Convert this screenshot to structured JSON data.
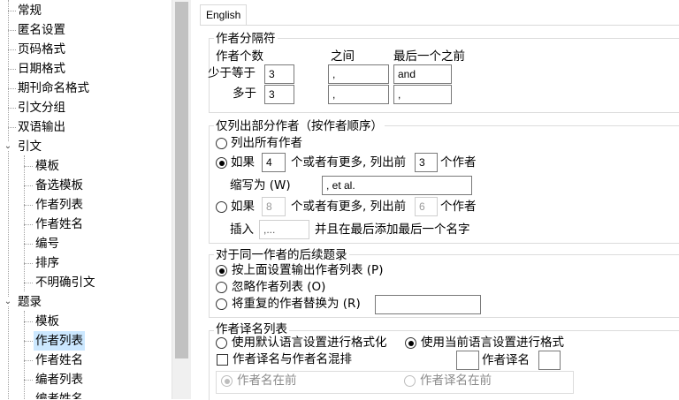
{
  "tree": {
    "items": [
      {
        "label": "常规",
        "level": 0
      },
      {
        "label": "匿名设置",
        "level": 0
      },
      {
        "label": "页码格式",
        "level": 0
      },
      {
        "label": "日期格式",
        "level": 0
      },
      {
        "label": "期刊命名格式",
        "level": 0
      },
      {
        "label": "引文分组",
        "level": 0
      },
      {
        "label": "双语输出",
        "level": 0
      },
      {
        "label": "引文",
        "level": 0,
        "expanded": true
      },
      {
        "label": "模板",
        "level": 1
      },
      {
        "label": "备选模板",
        "level": 1
      },
      {
        "label": "作者列表",
        "level": 1
      },
      {
        "label": "作者姓名",
        "level": 1
      },
      {
        "label": "编号",
        "level": 1
      },
      {
        "label": "排序",
        "level": 1
      },
      {
        "label": "不明确引文",
        "level": 1
      },
      {
        "label": "题录",
        "level": 0,
        "expanded": true
      },
      {
        "label": "模板",
        "level": 1
      },
      {
        "label": "作者列表",
        "level": 1,
        "selected": true
      },
      {
        "label": "作者姓名",
        "level": 1
      },
      {
        "label": "编者列表",
        "level": 1
      },
      {
        "label": "编者姓名",
        "level": 1
      }
    ]
  },
  "tabs": {
    "active": "English"
  },
  "separators": {
    "group_title": "作者分隔符",
    "col_count": "作者个数",
    "col_between": "之间",
    "col_before_last": "最后一个之前",
    "row_less_label": "少于等于",
    "row_less_count": "3",
    "row_less_between": ",",
    "row_less_before_last": "and",
    "row_more_label": "多于",
    "row_more_count": "3",
    "row_more_between": ",",
    "row_more_before_last": ","
  },
  "partial": {
    "group_title": "仅列出部分作者（按作者顺序）",
    "opt_all": "列出所有作者",
    "opt_if1_pre": "如果",
    "opt_if1_count": "4",
    "opt_if1_mid": "个或者有更多, 列出前",
    "opt_if1_first": "3",
    "opt_if1_post": "个作者",
    "abbr_label": "缩写为 (W)",
    "abbr_value": ", et al.",
    "opt_if2_pre": "如果",
    "opt_if2_count": "8",
    "opt_if2_mid": "个或者有更多, 列出前",
    "opt_if2_first": "6",
    "opt_if2_post": "个作者",
    "insert_label": "插入",
    "insert_value": ",...",
    "insert_post": "并且在最后添加最后一个名字"
  },
  "subsequent": {
    "group_title": "对于同一作者的后续题录",
    "opt_output": "按上面设置输出作者列表 (P)",
    "opt_ignore": "忽略作者列表 (O)",
    "opt_replace": "将重复的作者替换为 (R)",
    "replace_value": ""
  },
  "translation": {
    "group_title": "作者译名列表",
    "opt_default": "使用默认语言设置进行格式化",
    "opt_current": "使用当前语言设置进行格式",
    "mix_label": "作者译名与作者名混排",
    "translated_label": "作者译名",
    "sub_opt_author_first": "作者名在前",
    "sub_opt_translated_first": "作者译名在前"
  }
}
